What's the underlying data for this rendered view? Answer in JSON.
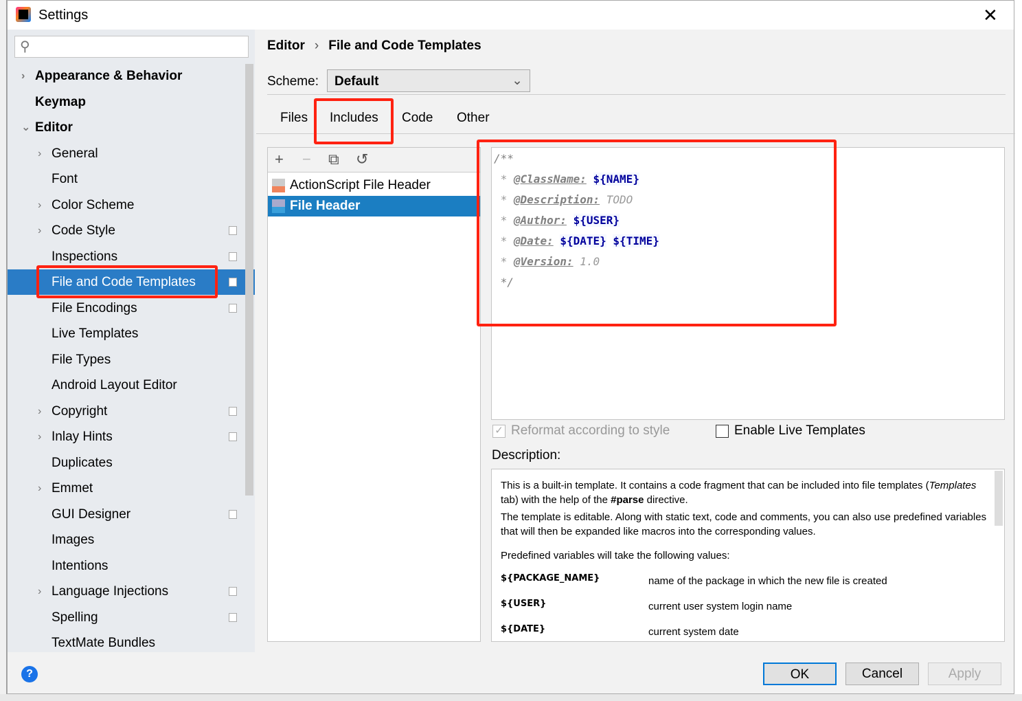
{
  "window": {
    "title": "Settings",
    "close": "✕"
  },
  "search": {
    "placeholder": "",
    "icon": "search-icon"
  },
  "tree": [
    {
      "label": "Appearance & Behavior",
      "bold": true,
      "arrow": "›",
      "level": 0,
      "proj": false
    },
    {
      "label": "Keymap",
      "bold": true,
      "arrow": "",
      "level": 0,
      "proj": false
    },
    {
      "label": "Editor",
      "bold": true,
      "arrow": "⌄",
      "level": 0,
      "proj": false
    },
    {
      "label": "General",
      "arrow": "›",
      "level": 1,
      "proj": false
    },
    {
      "label": "Font",
      "arrow": "",
      "level": 1,
      "proj": false
    },
    {
      "label": "Color Scheme",
      "arrow": "›",
      "level": 1,
      "proj": false
    },
    {
      "label": "Code Style",
      "arrow": "›",
      "level": 1,
      "proj": true
    },
    {
      "label": "Inspections",
      "arrow": "",
      "level": 1,
      "proj": true
    },
    {
      "label": "File and Code Templates",
      "arrow": "",
      "level": 1,
      "proj": true,
      "selected": true
    },
    {
      "label": "File Encodings",
      "arrow": "",
      "level": 1,
      "proj": true
    },
    {
      "label": "Live Templates",
      "arrow": "",
      "level": 1,
      "proj": false
    },
    {
      "label": "File Types",
      "arrow": "",
      "level": 1,
      "proj": false
    },
    {
      "label": "Android Layout Editor",
      "arrow": "",
      "level": 1,
      "proj": false
    },
    {
      "label": "Copyright",
      "arrow": "›",
      "level": 1,
      "proj": true
    },
    {
      "label": "Inlay Hints",
      "arrow": "›",
      "level": 1,
      "proj": true
    },
    {
      "label": "Duplicates",
      "arrow": "",
      "level": 1,
      "proj": false
    },
    {
      "label": "Emmet",
      "arrow": "›",
      "level": 1,
      "proj": false
    },
    {
      "label": "GUI Designer",
      "arrow": "",
      "level": 1,
      "proj": true
    },
    {
      "label": "Images",
      "arrow": "",
      "level": 1,
      "proj": false
    },
    {
      "label": "Intentions",
      "arrow": "",
      "level": 1,
      "proj": false
    },
    {
      "label": "Language Injections",
      "arrow": "›",
      "level": 1,
      "proj": true
    },
    {
      "label": "Spelling",
      "arrow": "",
      "level": 1,
      "proj": true
    },
    {
      "label": "TextMate Bundles",
      "arrow": "",
      "level": 1,
      "proj": false
    }
  ],
  "breadcrumb": {
    "parent": "Editor",
    "sep": "›",
    "current": "File and Code Templates"
  },
  "scheme": {
    "label": "Scheme:",
    "value": "Default"
  },
  "tabs": [
    "Files",
    "Includes",
    "Code",
    "Other"
  ],
  "active_tab": "Includes",
  "toolbar": {
    "add": "+",
    "remove": "−",
    "copy": "⧉",
    "reset": "↺"
  },
  "templates": [
    {
      "name": "ActionScript File Header",
      "badge": "AS",
      "color": "#f0845c"
    },
    {
      "name": "File Header",
      "badge": "J",
      "color": "#3aa0db",
      "selected": true
    }
  ],
  "code": {
    "open": "/**",
    "star": " * ",
    "close": " */",
    "lines": [
      {
        "tag": "@ClassName:",
        "vars": [
          "${NAME}"
        ]
      },
      {
        "tag": "@Description:",
        "text": "TODO"
      },
      {
        "tag": "@Author:",
        "vars": [
          "${USER}"
        ]
      },
      {
        "tag": "@Date:",
        "vars": [
          "${DATE}",
          "${TIME}"
        ]
      },
      {
        "tag": "@Version:",
        "text": "1.0"
      }
    ]
  },
  "options": {
    "reformat": "Reformat according to style",
    "reformat_checked": true,
    "live": "Enable Live Templates",
    "live_checked": false
  },
  "description": {
    "label": "Description:",
    "p1a": "This is a built-in template. It contains a code fragment that can be included into file templates (",
    "p1b": "Templates",
    "p1c": " tab) with the help of the ",
    "p1d": "#parse",
    "p1e": " directive.",
    "p2": "The template is editable. Along with static text, code and comments, you can also use predefined variables that will then be expanded like macros into the corresponding values.",
    "p3": "Predefined variables will take the following values:",
    "vars": [
      {
        "name": "${PACKAGE_NAME}",
        "desc": "name of the package in which the new file is created"
      },
      {
        "name": "${USER}",
        "desc": "current user system login name"
      },
      {
        "name": "${DATE}",
        "desc": "current system date"
      }
    ]
  },
  "buttons": {
    "ok": "OK",
    "cancel": "Cancel",
    "apply": "Apply",
    "help": "?"
  },
  "highlight_color": "#ff2211"
}
